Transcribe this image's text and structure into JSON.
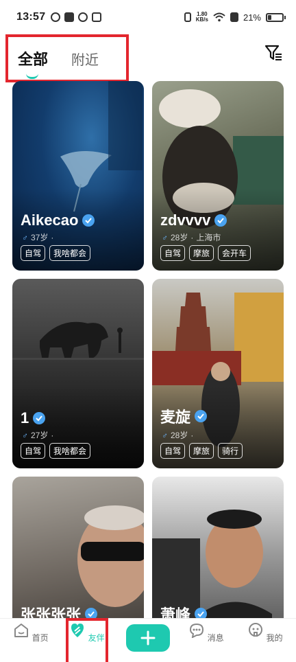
{
  "status_bar": {
    "time": "13:57",
    "speed_value": "1.80",
    "speed_unit": "KB/s",
    "battery": "21%",
    "battery_level": 0.21
  },
  "header": {
    "tabs": [
      {
        "label": "全部"
      },
      {
        "label": "附近"
      }
    ]
  },
  "cards": [
    {
      "name": "Aikecao",
      "age": "37岁",
      "location": "",
      "tags": [
        "自驾",
        "我啥都会"
      ]
    },
    {
      "name": "zdvvvv",
      "age": "28岁",
      "location": "上海市",
      "tags": [
        "自驾",
        "摩旅",
        "会开车"
      ]
    },
    {
      "name": "1",
      "age": "27岁",
      "location": "",
      "tags": [
        "自驾",
        "我啥都会"
      ]
    },
    {
      "name": "麦旋",
      "age": "28岁",
      "location": "",
      "tags": [
        "自驾",
        "摩旅",
        "骑行"
      ]
    },
    {
      "name": "张张张张",
      "age": "",
      "location": "",
      "tags": []
    },
    {
      "name": "萧峰",
      "age": "",
      "location": "",
      "tags": []
    }
  ],
  "bottom_nav": {
    "items": [
      {
        "label": "首页"
      },
      {
        "label": "友伴"
      },
      {
        "label": "消息"
      },
      {
        "label": "我的"
      }
    ],
    "accent": "#1ec9b0"
  },
  "colors": {
    "accent": "#1ec9b0",
    "highlight": "#e3262e",
    "verified": "#4aa3f0"
  }
}
